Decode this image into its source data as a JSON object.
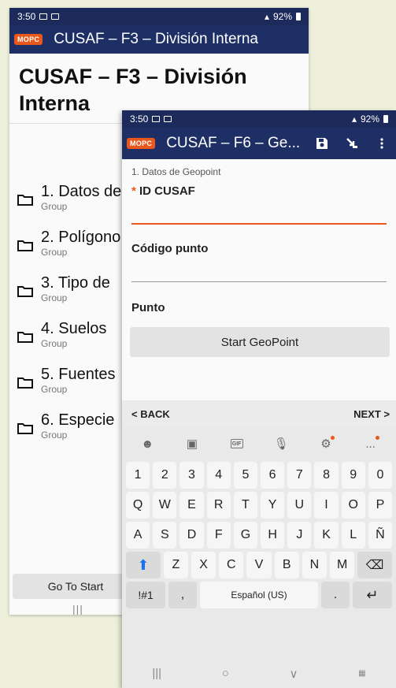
{
  "back_phone": {
    "status": {
      "time": "3:50",
      "battery": "92%"
    },
    "toolbar": {
      "logo": "MOPC",
      "title": "CUSAF – F3 – División Interna"
    },
    "form_title": "CUSAF – F3 – División Interna",
    "groups": [
      {
        "label": "1. Datos de",
        "sub": "Group"
      },
      {
        "label": "2. Polígono",
        "sub": "Group"
      },
      {
        "label": "3. Tipo de",
        "sub": "Group"
      },
      {
        "label": "4. Suelos",
        "sub": "Group"
      },
      {
        "label": "5. Fuentes",
        "sub": "Group"
      },
      {
        "label": "6. Especie",
        "sub": "Group"
      }
    ],
    "go_to_start": "Go To Start",
    "nav": {
      "recent": "|||"
    }
  },
  "front_phone": {
    "status": {
      "time": "3:50",
      "battery": "92%"
    },
    "toolbar": {
      "logo": "MOPC",
      "title": "CUSAF – F6 – Ge..."
    },
    "section_crumb": "1. Datos de Geopoint",
    "q_id": {
      "required_mark": "*",
      "label": "ID CUSAF",
      "value": ""
    },
    "q_codigo": {
      "label": "Código punto",
      "value": ""
    },
    "q_punto": {
      "label": "Punto"
    },
    "start_geopoint": "Start GeoPoint",
    "nav_back": "< BACK",
    "nav_next": "NEXT >",
    "keyboard": {
      "row_numbers": [
        "1",
        "2",
        "3",
        "4",
        "5",
        "6",
        "7",
        "8",
        "9",
        "0"
      ],
      "row_q": [
        "Q",
        "W",
        "E",
        "R",
        "T",
        "Y",
        "U",
        "I",
        "O",
        "P"
      ],
      "row_a": [
        "A",
        "S",
        "D",
        "F",
        "G",
        "H",
        "J",
        "K",
        "L",
        "Ñ"
      ],
      "row_z": [
        "Z",
        "X",
        "C",
        "V",
        "B",
        "N",
        "M"
      ],
      "symbols": "!#1",
      "comma": ",",
      "space": "Español (US)",
      "period": ".",
      "gif": "GIF",
      "more": "..."
    },
    "nav": {
      "recent": "|||",
      "home": "○",
      "back": "∨"
    }
  }
}
